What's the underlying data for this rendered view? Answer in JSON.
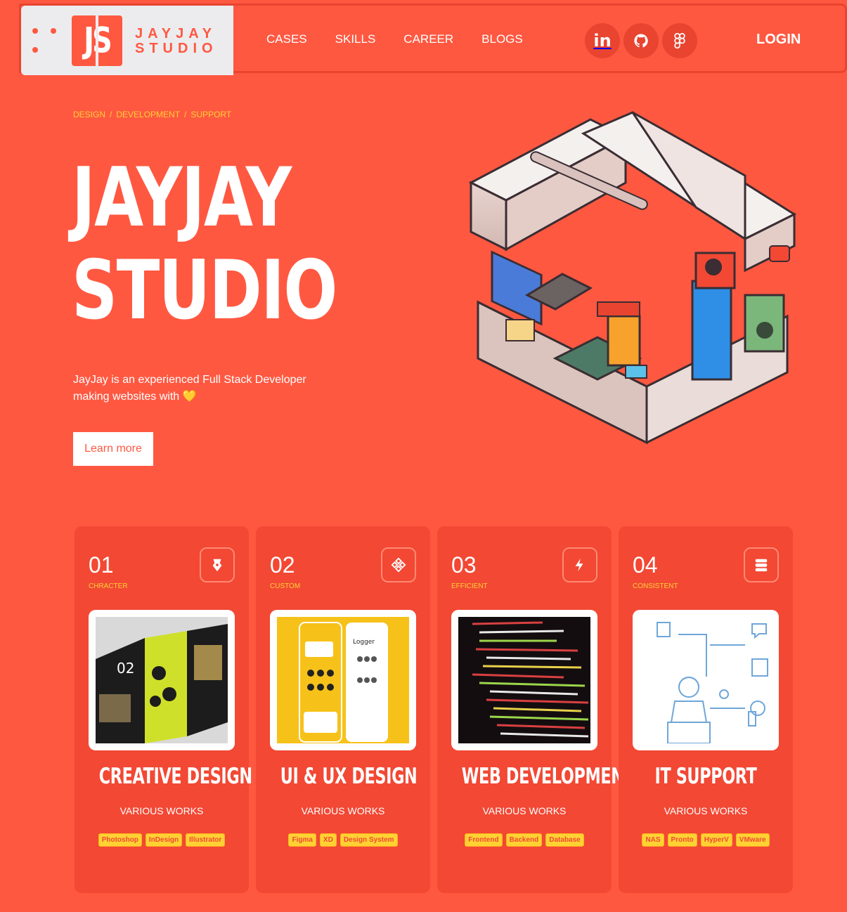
{
  "brand": {
    "mark": "JS",
    "line1": "JAYJAY",
    "line2": "STUDIO"
  },
  "nav": [
    "CASES",
    "SKILLS",
    "CAREER",
    "BLOGS"
  ],
  "social": [
    {
      "icon": "linkedin-icon",
      "label": "in"
    },
    {
      "icon": "github-icon"
    },
    {
      "icon": "figma-icon"
    }
  ],
  "login": "LOGIN",
  "hero": {
    "breadcrumb": [
      "DESIGN",
      "DEVELOPMENT",
      "SUPPORT"
    ],
    "title_line1": "JAYJAY",
    "title_line2": "STUDIO",
    "desc_line1": "JayJay is an experienced Full Stack Developer",
    "desc_line2": "making websites with",
    "heart": "💛",
    "cta": "Learn more"
  },
  "cards": [
    {
      "num": "01",
      "sub": "CHRACTER",
      "title": "CREATIVE DESIGN",
      "works": "VARIOUS WORKS",
      "tags": [
        "Photoshop",
        "InDesign",
        "Illustrator"
      ],
      "icon": "pen-nib-icon"
    },
    {
      "num": "02",
      "sub": "CUSTOM",
      "title": "UI & UX DESIGN",
      "works": "VARIOUS WORKS",
      "tags": [
        "Figma",
        "XD",
        "Design System"
      ],
      "icon": "component-icon"
    },
    {
      "num": "03",
      "sub": "EFFICIENT",
      "title": "WEB DEVELOPMENT",
      "works": "VARIOUS WORKS",
      "tags": [
        "Frontend",
        "Backend",
        "Database"
      ],
      "icon": "lightning-icon"
    },
    {
      "num": "04",
      "sub": "CONSISTENT",
      "title": "IT SUPPORT",
      "works": "VARIOUS WORKS",
      "tags": [
        "NAS",
        "Pronto",
        "HyperV",
        "VMware"
      ],
      "icon": "server-icon"
    }
  ],
  "colors": {
    "accent": "#ff5841",
    "card": "#f24834",
    "highlight": "#ffd233"
  }
}
